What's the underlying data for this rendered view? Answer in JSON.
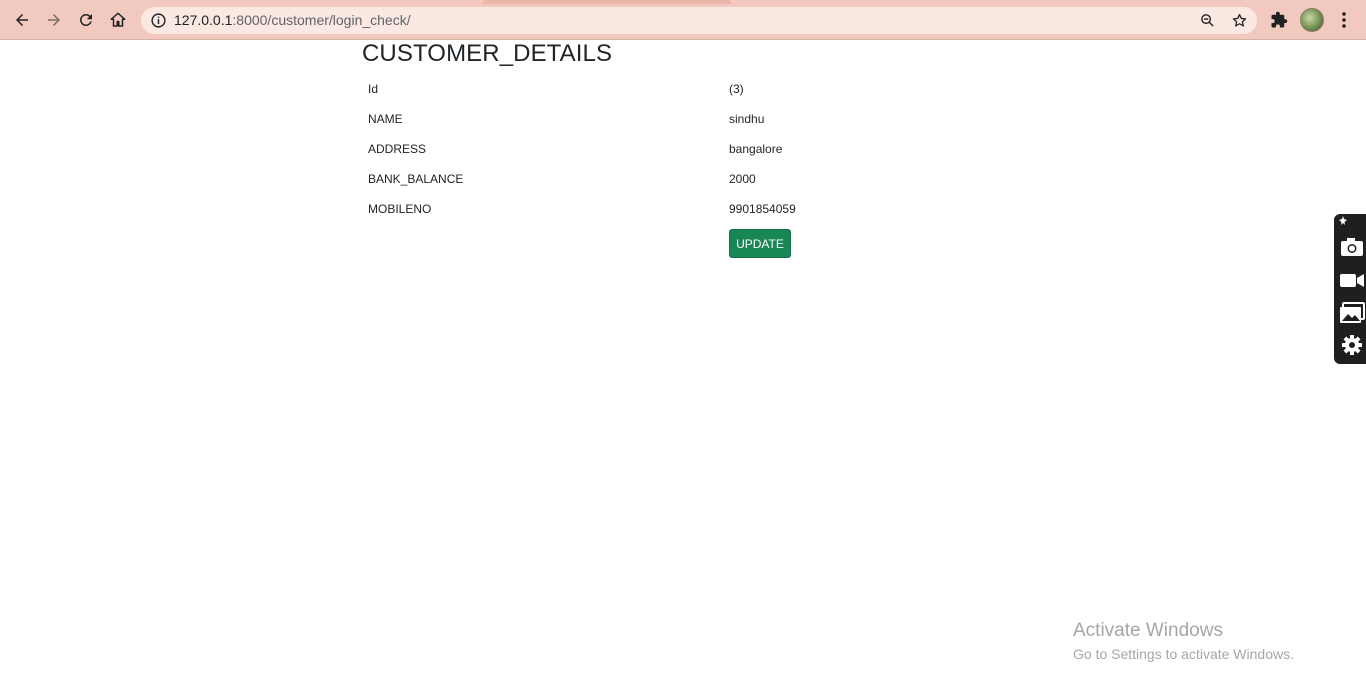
{
  "browser": {
    "url_host": "127.0.0.1",
    "url_rest": ":8000/customer/login_check/"
  },
  "page": {
    "title": "CUSTOMER_DETAILS",
    "fields": [
      {
        "label": "Id",
        "value": "(3)"
      },
      {
        "label": "NAME",
        "value": "sindhu"
      },
      {
        "label": "ADDRESS",
        "value": "bangalore"
      },
      {
        "label": "BANK_BALANCE",
        "value": "2000"
      },
      {
        "label": "MOBILENO",
        "value": "9901854059"
      }
    ],
    "update_label": "UPDATE"
  },
  "watermark": {
    "line1": "Activate Windows",
    "line2": "Go to Settings to activate Windows."
  },
  "colors": {
    "toolbar": "#f2c9bf",
    "button": "#198754"
  }
}
